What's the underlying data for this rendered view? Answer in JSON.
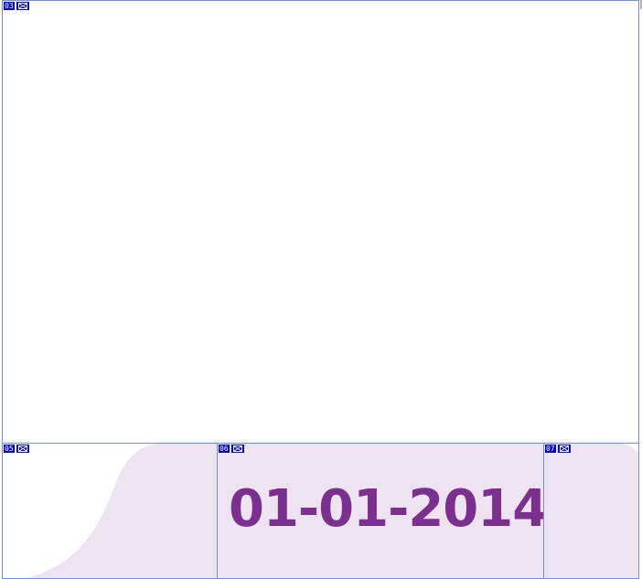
{
  "slices": [
    {
      "label": "03",
      "icon": "image-placeholder-icon"
    },
    {
      "label": "05",
      "icon": "image-placeholder-icon"
    },
    {
      "label": "06",
      "icon": "image-placeholder-icon"
    },
    {
      "label": "07",
      "icon": "image-placeholder-icon"
    }
  ],
  "banner": {
    "date": "01-01-2014"
  },
  "colors": {
    "slice_border": "#6f8fe0",
    "slice_tag_bg": "#0000cc",
    "banner_bg": "#ede3f1",
    "date_text": "#7b2f8f"
  }
}
